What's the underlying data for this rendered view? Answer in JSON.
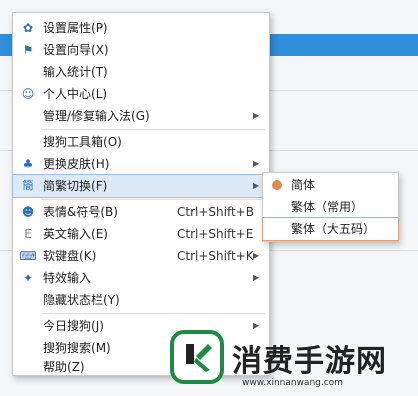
{
  "menu": {
    "items": [
      {
        "icon": "gear-icon",
        "label": "设置属性",
        "shortcut_key": "(P)",
        "has_submenu": false
      },
      {
        "icon": "flag-icon",
        "label": "设置向导",
        "shortcut_key": "(X)",
        "has_submenu": false
      },
      {
        "icon": "",
        "label": "输入统计",
        "shortcut_key": "(T)",
        "has_submenu": false
      },
      {
        "icon": "user-icon",
        "label": "个人中心",
        "shortcut_key": "(L)",
        "has_submenu": false
      },
      {
        "icon": "",
        "label": "管理/修复输入法",
        "shortcut_key": "(G)",
        "has_submenu": true
      },
      {
        "icon": "",
        "label": "搜狗工具箱",
        "shortcut_key": "(O)",
        "has_submenu": false
      },
      {
        "icon": "shirt-icon",
        "label": "更换皮肤",
        "shortcut_key": "(H)",
        "has_submenu": true
      },
      {
        "icon": "simplified-traditional-icon",
        "label": "简繁切换",
        "shortcut_key": "(F)",
        "has_submenu": true
      },
      {
        "icon": "smiley-icon",
        "label": "表情&符号",
        "shortcut_key": "(B)",
        "accelerator": "Ctrl+Shift+B",
        "has_submenu": false
      },
      {
        "icon": "letter-e-icon",
        "label": "英文输入",
        "shortcut_key": "(E)",
        "accelerator": "Ctrl+Shift+E",
        "has_submenu": false
      },
      {
        "icon": "keyboard-icon",
        "label": "软键盘",
        "shortcut_key": "(K)",
        "accelerator": "Ctrl+Shift+K",
        "has_submenu": true
      },
      {
        "icon": "effects-icon",
        "label": "特效输入",
        "shortcut_key": "",
        "has_submenu": true
      },
      {
        "icon": "",
        "label": "隐藏状态栏",
        "shortcut_key": "(Y)",
        "has_submenu": false
      },
      {
        "icon": "",
        "label": "今日搜狗",
        "shortcut_key": "(J)",
        "has_submenu": true
      },
      {
        "icon": "",
        "label": "搜狗搜索",
        "shortcut_key": "(M)",
        "has_submenu": false
      },
      {
        "icon": "",
        "label": "帮助",
        "shortcut_key": "(Z)",
        "has_submenu": false
      }
    ]
  },
  "submenu": {
    "items": [
      {
        "label": "简体",
        "selected": true
      },
      {
        "label": "繁体（常用）",
        "selected": false
      },
      {
        "label": "繁体（大五码）",
        "selected": false
      }
    ]
  },
  "watermark": {
    "title": "消费手游网",
    "url": "www.xinnanwang.com"
  },
  "colors": {
    "accent": "#2f8fd8",
    "highlight": "#dde9f7",
    "selected_dot": "#e28a4f",
    "logo_green": "#1e8b43"
  }
}
